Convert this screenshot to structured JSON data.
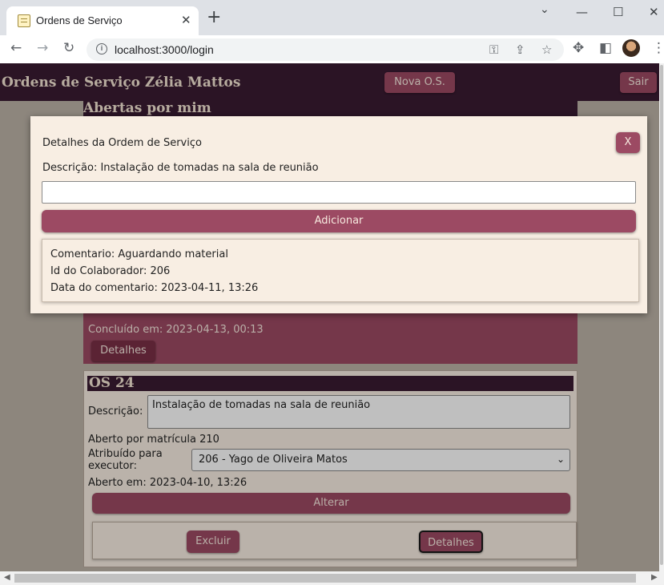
{
  "browser": {
    "tab_title": "Ordens de Serviço",
    "tab_close": "✕",
    "new_tab": "+",
    "url": "localhost:3000/login",
    "win_minimize": "—",
    "win_restore": "☐",
    "win_close": "✕",
    "menu_dots": "⋮"
  },
  "app": {
    "brand": "Ordens de Serviço Zélia Mattos",
    "new_os_button": "Nova O.S.",
    "logout_button": "Sair",
    "section_heading": "Abertas por mim",
    "completed_text": "Concluído em: 2023-04-13, 00:13",
    "completed_details_button": "Detalhes"
  },
  "os_card": {
    "title": "OS 24",
    "description_label": "Descrição:",
    "description_value": "Instalação de tomadas na sala de reunião",
    "opened_by": "Aberto por matrícula 210",
    "assigned_label": "Atribuído para executor:",
    "assigned_value": "206 - Yago de Oliveira Matos",
    "opened_at": "Aberto em: 2023-04-10, 13:26",
    "change_button": "Alterar",
    "delete_button": "Excluir",
    "details_button": "Detalhes"
  },
  "modal": {
    "title": "Detalhes da Ordem de Serviço",
    "description": "Descrição: Instalação de tomadas na sala de reunião",
    "close_button": "X",
    "comment_input_value": "",
    "add_button": "Adicionar",
    "comment": {
      "text": "Comentario: Aguardando material",
      "collaborator": "Id do Colaborador: 206",
      "date": "Data do comentario: 2023-04-11, 13:26"
    }
  },
  "colors": {
    "app_dark": "#3a1b32",
    "accent": "#9c4a63",
    "card_bg": "#f8eee3"
  }
}
